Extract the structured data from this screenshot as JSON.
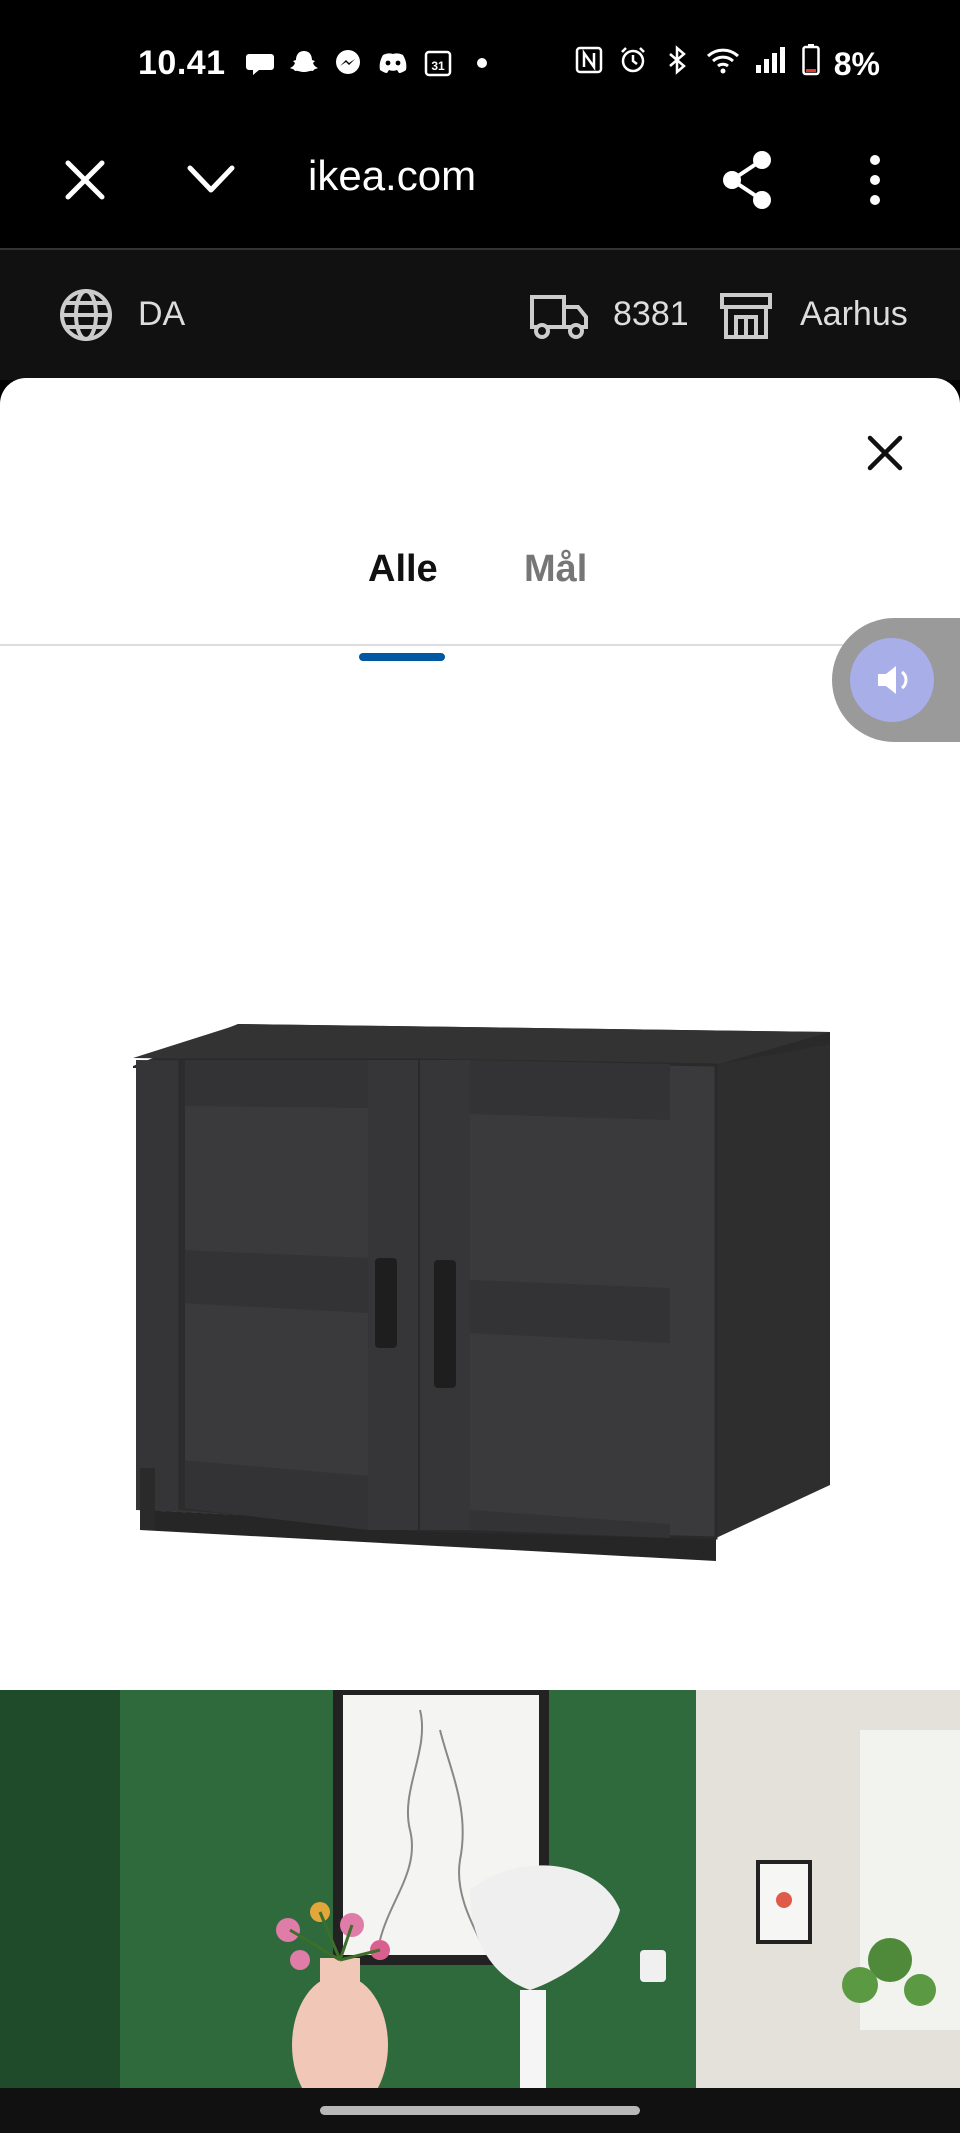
{
  "status": {
    "time": "10.41",
    "battery": "8%",
    "notif_icons": [
      "chat-bubble-icon",
      "snapchat-icon",
      "messenger-icon",
      "discord-icon",
      "calendar-icon",
      "dot-icon"
    ],
    "calendar_day": "31",
    "sys_icons": [
      "nfc-icon",
      "alarm-icon",
      "bluetooth-icon",
      "wifi-icon",
      "signal-icon",
      "battery-icon"
    ]
  },
  "browser": {
    "url": "ikea.com",
    "icons": [
      "close-icon",
      "chevron-down-icon",
      "share-icon",
      "more-vert-icon"
    ]
  },
  "ikea_header": {
    "language": "DA",
    "zipcode": "8381",
    "store": "Aarhus",
    "icons": [
      "globe-icon",
      "truck-icon",
      "store-icon"
    ]
  },
  "sheet": {
    "tabs": [
      {
        "label": "Alle",
        "active": true
      },
      {
        "label": "Mål",
        "active": false
      }
    ],
    "close_icon": "close-icon",
    "accent_color": "#0058a3"
  },
  "floating": {
    "icon": "sound-icon"
  }
}
